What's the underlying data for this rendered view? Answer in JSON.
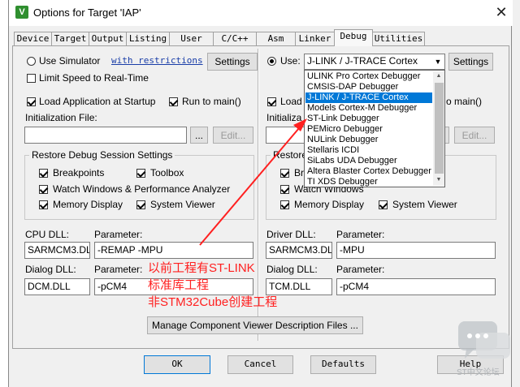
{
  "window": {
    "title": "Options for Target 'IAP'",
    "icon": "keil-app-icon",
    "close_glyph": "✕"
  },
  "tabs": [
    "Device",
    "Target",
    "Output",
    "Listing",
    "User",
    "C/C++",
    "Asm",
    "Linker",
    "Debug",
    "Utilities"
  ],
  "active_tab": "Debug",
  "left": {
    "use_simulator": "Use Simulator",
    "with_restrictions": "with restrictions",
    "settings": "Settings",
    "limit_speed": "Limit Speed to Real-Time",
    "load_app": "Load Application at Startup",
    "run_to_main": "Run to main()",
    "init_file_label": "Initialization File:",
    "browse": "...",
    "edit": "Edit...",
    "restore_title": "Restore Debug Session Settings",
    "breakpoints": "Breakpoints",
    "toolbox": "Toolbox",
    "watch_windows": "Watch Windows & Performance Analyzer",
    "memory_display": "Memory Display",
    "system_viewer": "System Viewer",
    "cpu_dll_label": "CPU DLL:",
    "param_label": "Parameter:",
    "cpu_dll": "SARMCM3.DLL",
    "cpu_param": "-REMAP -MPU",
    "dialog_dll_label": "Dialog DLL:",
    "dialog_dll": "DCM.DLL",
    "dialog_param": "-pCM4"
  },
  "right": {
    "use": "Use:",
    "debugger": "J-LINK / J-TRACE Cortex",
    "settings": "Settings",
    "load": "Load",
    "run_to_main_partial": "o main()",
    "init_partial": "Initializa",
    "browse": "...",
    "edit": "Edit...",
    "restore_partial": "Restore",
    "bre_partial": "Bre",
    "watch_windows": "Watch Windows",
    "memory_display": "Memory Display",
    "system_viewer": "System Viewer",
    "driver_dll_label": "Driver DLL:",
    "param_label": "Parameter:",
    "driver_dll": "SARMCM3.DLL",
    "driver_param": "-MPU",
    "dialog_dll_label": "Dialog DLL:",
    "dialog_dll": "TCM.DLL",
    "dialog_param": "-pCM4"
  },
  "dropdown": {
    "items": [
      "ULINK Pro Cortex Debugger",
      "CMSIS-DAP Debugger",
      "J-LINK / J-TRACE Cortex",
      "Models Cortex-M Debugger",
      "ST-Link Debugger",
      "PEMicro Debugger",
      "NULink Debugger",
      "Stellaris ICDI",
      "SiLabs UDA Debugger",
      "Altera Blaster Cortex Debugger",
      "TI XDS Debugger"
    ],
    "selected_index": 2
  },
  "annotation": {
    "lines": [
      "以前工程有ST-LINK",
      "标准库工程",
      "非STM32Cube创建工程"
    ],
    "color": "#ff2020"
  },
  "manage_button": "Manage Component Viewer Description Files ...",
  "footer": {
    "ok": "OK",
    "cancel": "Cancel",
    "defaults": "Defaults",
    "help": "Help"
  },
  "watermark": {
    "text": "ST中文论坛",
    "icon": "chat-bubble-icon"
  }
}
